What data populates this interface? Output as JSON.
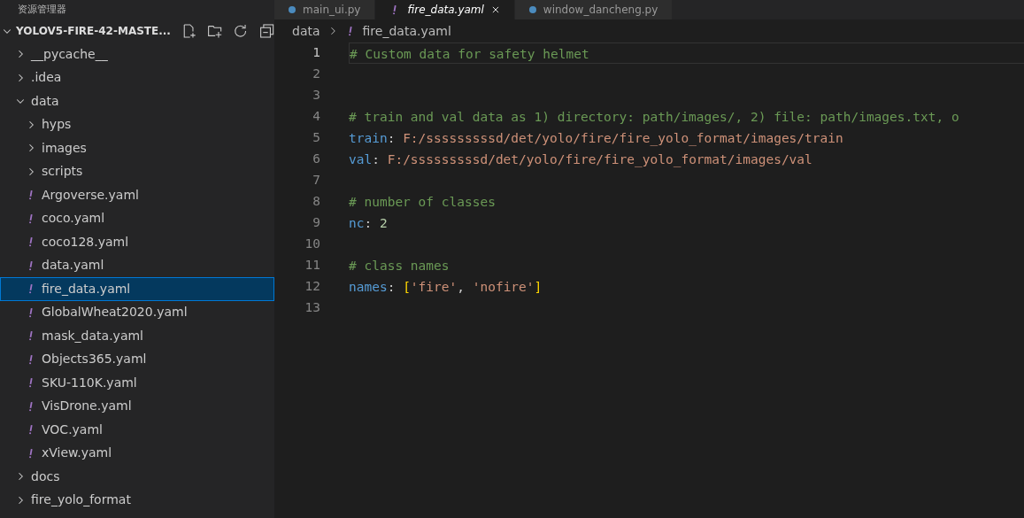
{
  "sidebar": {
    "title": "资源管理器",
    "project": {
      "name": "YOLOV5-FIRE-42-MASTE...",
      "expanded": true
    },
    "tree": [
      {
        "label": "__pycache__",
        "kind": "folder",
        "expanded": false,
        "selected": false
      },
      {
        "label": ".idea",
        "kind": "folder",
        "expanded": false,
        "selected": false
      },
      {
        "label": "data",
        "kind": "folder",
        "expanded": true,
        "selected": false,
        "children": [
          {
            "label": "hyps",
            "kind": "folder",
            "expanded": false,
            "selected": false
          },
          {
            "label": "images",
            "kind": "folder",
            "expanded": false,
            "selected": false
          },
          {
            "label": "scripts",
            "kind": "folder",
            "expanded": false,
            "selected": false
          },
          {
            "label": "Argoverse.yaml",
            "kind": "yaml",
            "selected": false
          },
          {
            "label": "coco.yaml",
            "kind": "yaml",
            "selected": false
          },
          {
            "label": "coco128.yaml",
            "kind": "yaml",
            "selected": false
          },
          {
            "label": "data.yaml",
            "kind": "yaml",
            "selected": false
          },
          {
            "label": "fire_data.yaml",
            "kind": "yaml",
            "selected": true
          },
          {
            "label": "GlobalWheat2020.yaml",
            "kind": "yaml",
            "selected": false
          },
          {
            "label": "mask_data.yaml",
            "kind": "yaml",
            "selected": false
          },
          {
            "label": "Objects365.yaml",
            "kind": "yaml",
            "selected": false
          },
          {
            "label": "SKU-110K.yaml",
            "kind": "yaml",
            "selected": false
          },
          {
            "label": "VisDrone.yaml",
            "kind": "yaml",
            "selected": false
          },
          {
            "label": "VOC.yaml",
            "kind": "yaml",
            "selected": false
          },
          {
            "label": "xView.yaml",
            "kind": "yaml",
            "selected": false
          }
        ]
      },
      {
        "label": "docs",
        "kind": "folder",
        "expanded": false,
        "selected": false
      },
      {
        "label": "fire_yolo_format",
        "kind": "folder",
        "expanded": false,
        "selected": false
      }
    ]
  },
  "tabs": [
    {
      "label": "main_ui.py",
      "kind": "python",
      "selected": false
    },
    {
      "label": "fire_data.yaml",
      "kind": "yaml",
      "selected": true
    },
    {
      "label": "window_dancheng.py",
      "kind": "python",
      "selected": false
    }
  ],
  "breadcrumb": [
    {
      "label": "data",
      "kind": "folder"
    },
    {
      "label": "fire_data.yaml",
      "kind": "yaml"
    }
  ],
  "code": [
    {
      "number": "1",
      "current": true,
      "tokens": [
        {
          "text": "# Custom data for safety helmet",
          "kind": "comment"
        }
      ]
    },
    {
      "number": "2",
      "current": false
    },
    {
      "number": "3",
      "current": false
    },
    {
      "number": "4",
      "current": false,
      "tokens": [
        {
          "text": "# train and val data as 1) directory: path/images/, 2) file: path/images.txt, o",
          "kind": "comment"
        }
      ]
    },
    {
      "number": "5",
      "current": false,
      "tokens": [
        {
          "text": "train",
          "kind": "key"
        },
        {
          "text": ": ",
          "kind": "plain"
        },
        {
          "text": "F:/sssssssssd/det/yolo/fire/fire_yolo_format/images/train",
          "kind": "string"
        }
      ]
    },
    {
      "number": "6",
      "current": false,
      "tokens": [
        {
          "text": "val",
          "kind": "key"
        },
        {
          "text": ": ",
          "kind": "plain"
        },
        {
          "text": "F:/sssssssssd/det/yolo/fire/fire_yolo_format/images/val",
          "kind": "string"
        }
      ]
    },
    {
      "number": "7",
      "current": false
    },
    {
      "number": "8",
      "current": false,
      "tokens": [
        {
          "text": "# number of classes",
          "kind": "comment"
        }
      ]
    },
    {
      "number": "9",
      "current": false,
      "tokens": [
        {
          "text": "nc",
          "kind": "key"
        },
        {
          "text": ": ",
          "kind": "plain"
        },
        {
          "text": "2",
          "kind": "number"
        }
      ]
    },
    {
      "number": "10",
      "current": false
    },
    {
      "number": "11",
      "current": false,
      "tokens": [
        {
          "text": "# class names",
          "kind": "comment"
        }
      ]
    },
    {
      "number": "12",
      "current": false,
      "tokens": [
        {
          "text": "names",
          "kind": "key"
        },
        {
          "text": ": ",
          "kind": "plain"
        },
        {
          "text": "[",
          "kind": "bracket"
        },
        {
          "text": "'fire'",
          "kind": "string"
        },
        {
          "text": ", ",
          "kind": "plain"
        },
        {
          "text": "'nofire'",
          "kind": "string"
        },
        {
          "text": "]",
          "kind": "bracket"
        }
      ]
    },
    {
      "number": "13",
      "current": false
    }
  ]
}
